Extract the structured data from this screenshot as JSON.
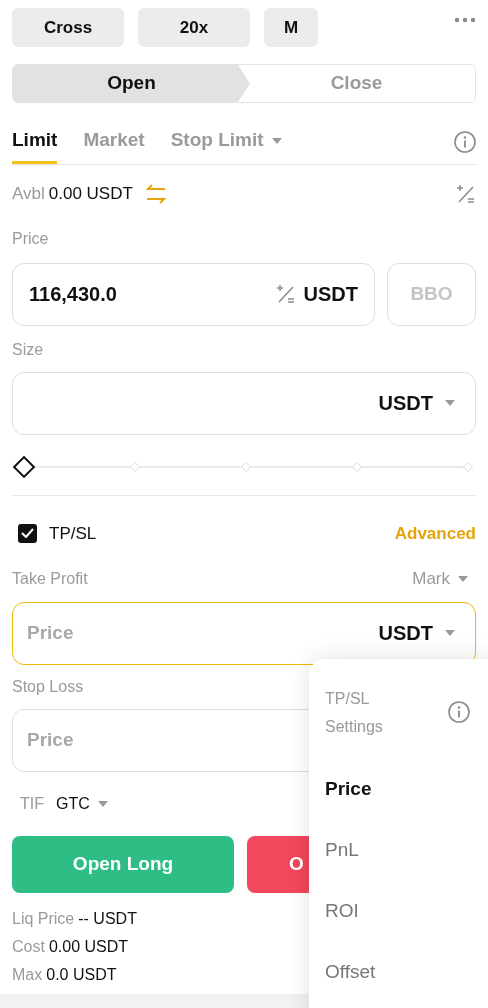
{
  "top_buttons": [
    {
      "label": "Cross"
    },
    {
      "label": "20x"
    },
    {
      "label": "M"
    }
  ],
  "side_tabs": [
    {
      "label": "Open",
      "selected": true
    },
    {
      "label": "Close",
      "selected": false
    }
  ],
  "order_tabs": [
    {
      "label": "Limit",
      "selected": true,
      "dropdown": false
    },
    {
      "label": "Market",
      "selected": false,
      "dropdown": false
    },
    {
      "label": "Stop Limit",
      "selected": false,
      "dropdown": true
    }
  ],
  "available": {
    "label": "Avbl",
    "value": "0.00 USDT"
  },
  "price": {
    "label": "Price",
    "value": "116,430.0",
    "unit": "USDT",
    "bbo": "BBO"
  },
  "size": {
    "label": "Size",
    "unit": "USDT"
  },
  "size_slider": {
    "level": 0
  },
  "tpsl": {
    "label": "TP/SL",
    "checked": true,
    "advanced": "Advanced"
  },
  "take_profit": {
    "label": "Take Profit",
    "trigger": "Mark",
    "placeholder": "Price",
    "unit": "USDT",
    "focused": true
  },
  "stop_loss": {
    "label": "Stop Loss",
    "placeholder": "Price",
    "focused": false
  },
  "tif": {
    "label": "TIF",
    "value": "GTC"
  },
  "actions": [
    {
      "label": "Open Long",
      "kind": "long"
    },
    {
      "label": "O",
      "kind": "short"
    }
  ],
  "summary": [
    {
      "label": "Liq Price",
      "value": "-- USDT"
    },
    {
      "label": "Cost",
      "value": "0.00 USDT"
    },
    {
      "label": "Max",
      "value": "0.0 USDT"
    }
  ],
  "tpsl_menu": {
    "title": "TP/SL Settings",
    "items": [
      {
        "label": "Price",
        "selected": true
      },
      {
        "label": "PnL",
        "selected": false
      },
      {
        "label": "ROI",
        "selected": false
      },
      {
        "label": "Offset",
        "selected": false
      }
    ]
  }
}
